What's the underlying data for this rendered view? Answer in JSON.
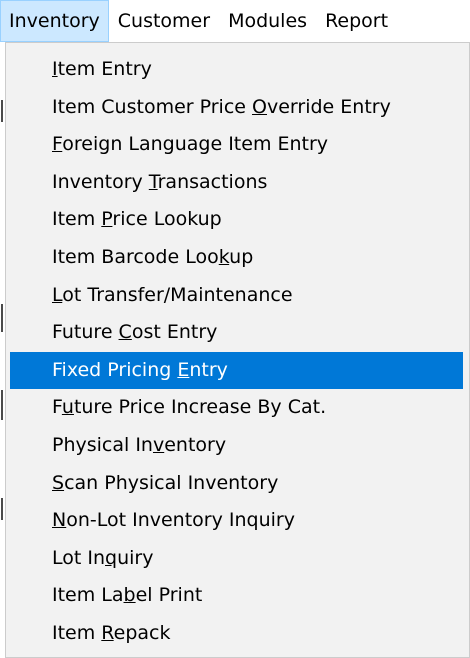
{
  "menubar": {
    "items": [
      {
        "label": "Inventory",
        "open": true
      },
      {
        "label": "Customer"
      },
      {
        "label": "Modules"
      },
      {
        "label": "Report"
      }
    ]
  },
  "dropdown": {
    "highlight_color": "#0078d7",
    "items": [
      {
        "label": "Item Entry",
        "mnemonic": "I"
      },
      {
        "label": "Item Customer Price Override Entry",
        "mnemonic": "O"
      },
      {
        "label": "Foreign Language Item Entry",
        "mnemonic": "F"
      },
      {
        "label": "Inventory Transactions",
        "mnemonic": "T"
      },
      {
        "label": "Item Price Lookup",
        "mnemonic": "P"
      },
      {
        "label": "Item Barcode Lookup",
        "mnemonic": "k"
      },
      {
        "label": "Lot Transfer/Maintenance",
        "mnemonic": "L"
      },
      {
        "label": "Future Cost Entry",
        "mnemonic": "C"
      },
      {
        "label": "Fixed Pricing Entry",
        "mnemonic": "E",
        "highlighted": true
      },
      {
        "label": "Future Price Increase By Cat.",
        "mnemonic": "u"
      },
      {
        "label": "Physical Inventory",
        "mnemonic": "v"
      },
      {
        "label": "Scan Physical Inventory",
        "mnemonic": "S"
      },
      {
        "label": "Non-Lot Inventory Inquiry",
        "mnemonic": "N"
      },
      {
        "label": "Lot Inquiry",
        "mnemonic": "q"
      },
      {
        "label": "Item Label Print",
        "mnemonic": "b"
      },
      {
        "label": "Item Repack",
        "mnemonic": "R"
      }
    ]
  }
}
